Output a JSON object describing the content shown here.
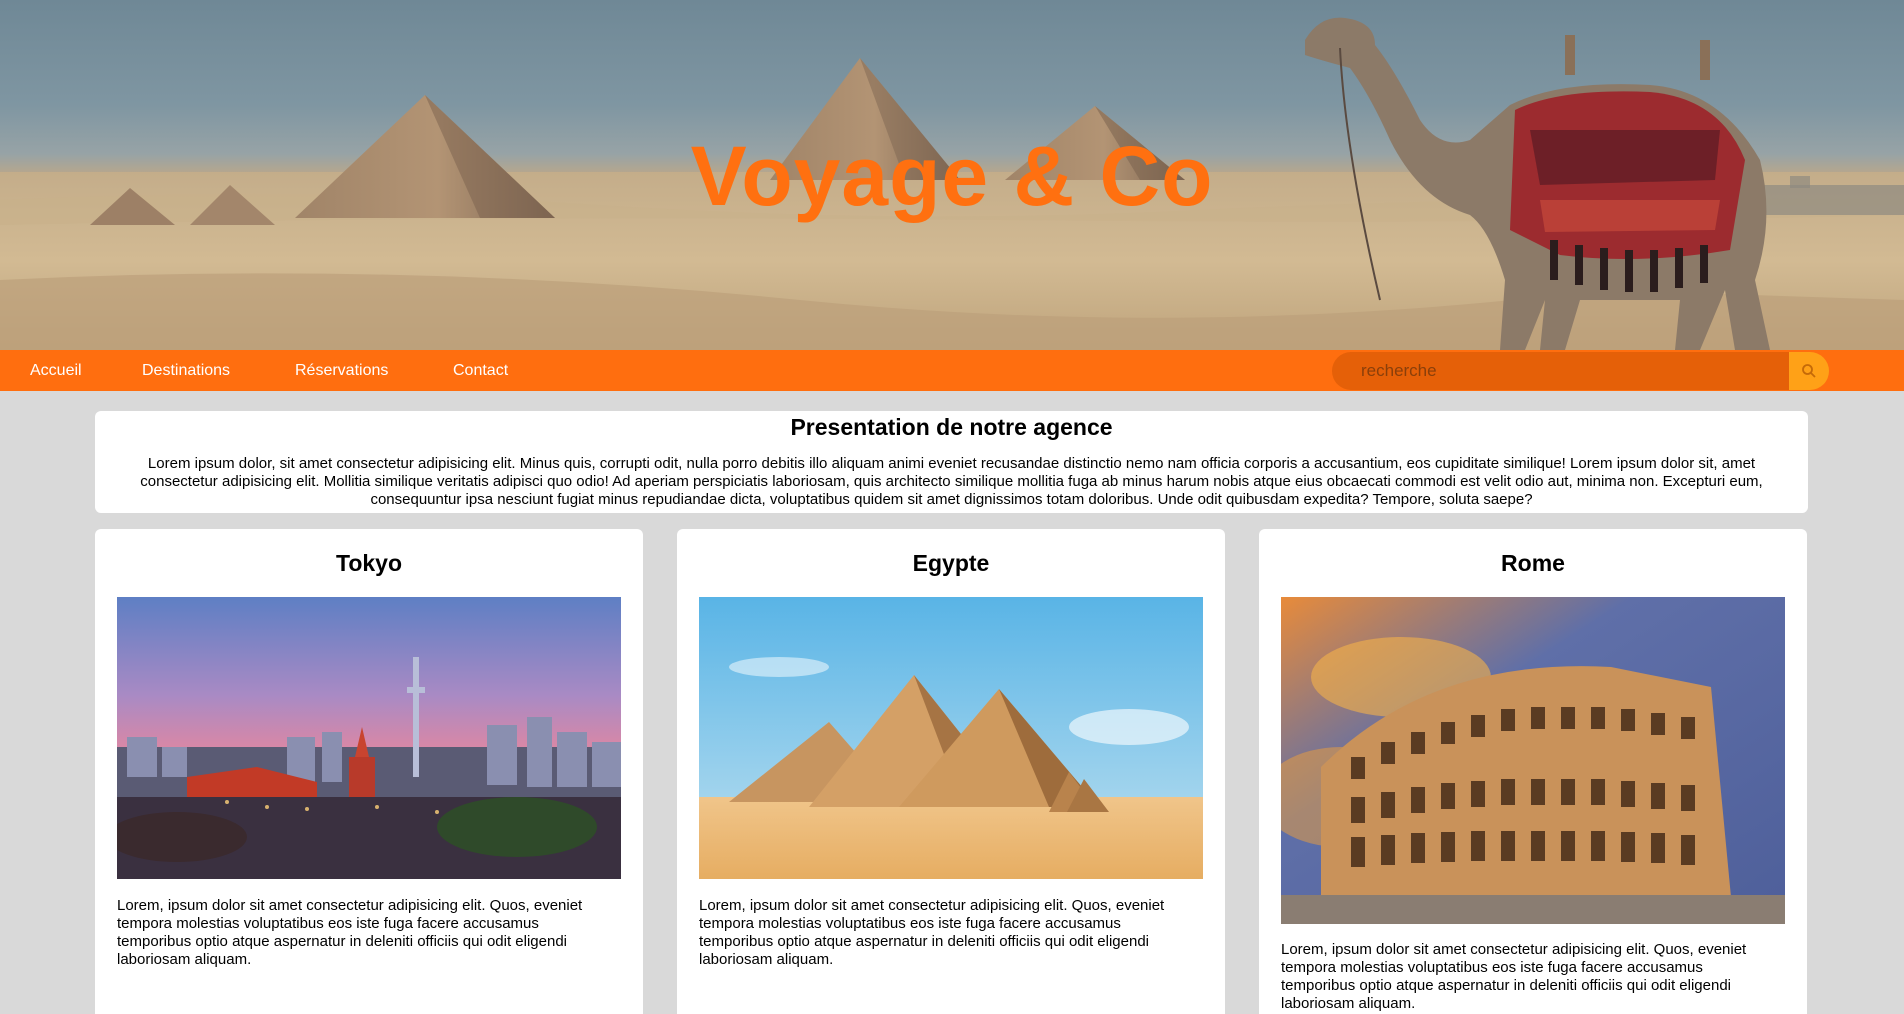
{
  "hero": {
    "title": "Voyage & Co"
  },
  "nav": {
    "items": [
      "Accueil",
      "Destinations",
      "Réservations",
      "Contact"
    ],
    "search_placeholder": "recherche",
    "search_icon": "search-icon"
  },
  "presentation": {
    "title": "Presentation de notre agence",
    "text": "Lorem ipsum dolor, sit amet consectetur adipisicing elit. Minus quis, corrupti odit, nulla porro debitis illo aliquam animi eveniet recusandae distinctio nemo nam officia corporis a accusantium, eos cupiditate similique! Lorem ipsum dolor sit, amet consectetur adipisicing elit. Mollitia similique veritatis adipisci quo odio! Ad aperiam perspiciatis laboriosam, quis architecto similique mollitia fuga ab minus harum nobis atque eius obcaecati commodi est velit odio aut, minima non. Excepturi eum, consequuntur ipsa nesciunt fugiat minus repudiandae dicta, voluptatibus quidem sit amet dignissimos totam doloribus. Unde odit quibusdam expedita? Tempore, soluta saepe?"
  },
  "cards": [
    {
      "title": "Tokyo",
      "text": "Lorem, ipsum dolor sit amet consectetur adipisicing elit. Quos, eveniet tempora molestias voluptatibus eos iste fuga facere accusamus temporibus optio atque aspernatur in deleniti officiis qui odit eligendi laboriosam aliquam."
    },
    {
      "title": "Egypte",
      "text": "Lorem, ipsum dolor sit amet consectetur adipisicing elit. Quos, eveniet tempora molestias voluptatibus eos iste fuga facere accusamus temporibus optio atque aspernatur in deleniti officiis qui odit eligendi laboriosam aliquam."
    },
    {
      "title": "Rome",
      "text": "Lorem, ipsum dolor sit amet consectetur adipisicing elit. Quos, eveniet tempora molestias voluptatibus eos iste fuga facere accusamus temporibus optio atque aspernatur in deleniti officiis qui odit eligendi laboriosam aliquam."
    }
  ],
  "colors": {
    "accent": "#ff6e0f",
    "title_orange": "#ff7010",
    "search_button": "#ffa117",
    "background": "#d9d9d9"
  }
}
